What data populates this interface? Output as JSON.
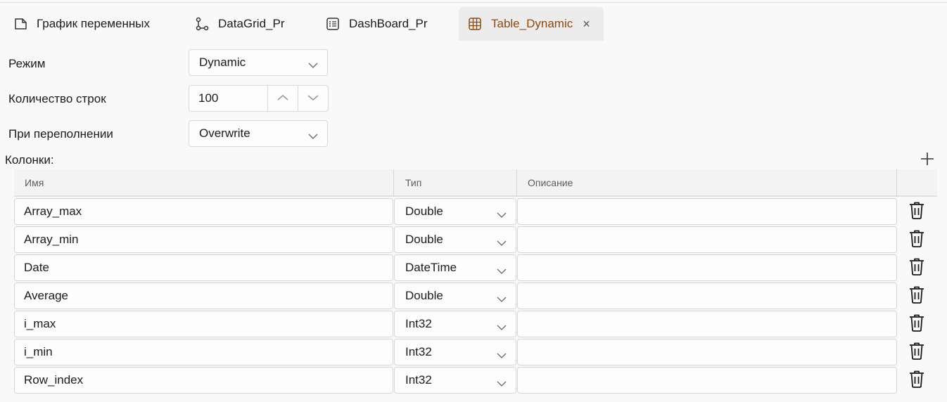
{
  "tabs": [
    {
      "label": "График переменных",
      "icon": "document-icon"
    },
    {
      "label": "DataGrid_Pr",
      "icon": "branch-icon"
    },
    {
      "label": "DashBoard_Pr",
      "icon": "list-icon"
    },
    {
      "label": "Table_Dynamic",
      "icon": "table-icon",
      "active": true,
      "close": "×"
    }
  ],
  "form": {
    "mode": {
      "label": "Режим",
      "value": "Dynamic"
    },
    "rows": {
      "label": "Количество строк",
      "value": "100"
    },
    "overflow": {
      "label": "При переполнении",
      "value": "Overwrite"
    }
  },
  "columns": {
    "label": "Колонки:",
    "headers": {
      "name": "Имя",
      "type": "Тип",
      "description": "Описание"
    },
    "rows": [
      {
        "name": "Array_max",
        "type": "Double",
        "description": ""
      },
      {
        "name": "Array_min",
        "type": "Double",
        "description": ""
      },
      {
        "name": "Date",
        "type": "DateTime",
        "description": ""
      },
      {
        "name": "Average",
        "type": "Double",
        "description": ""
      },
      {
        "name": "i_max",
        "type": "Int32",
        "description": ""
      },
      {
        "name": "i_min",
        "type": "Int32",
        "description": ""
      },
      {
        "name": "Row_index",
        "type": "Int32",
        "description": ""
      }
    ]
  },
  "colors": {
    "accent": "#8a4a0f",
    "active_tab_bg": "#ececec"
  }
}
